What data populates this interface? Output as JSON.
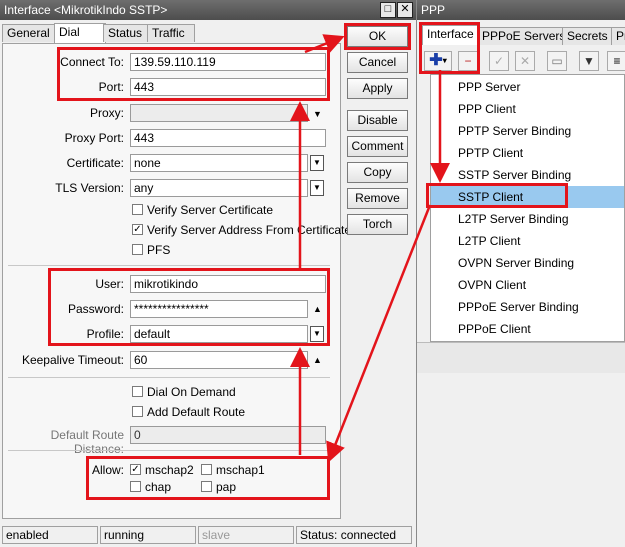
{
  "left_window": {
    "title": "Interface <MikrotikIndo SSTP>",
    "tabs": [
      "General",
      "Dial Out",
      "Status",
      "Traffic"
    ],
    "fields": {
      "connect_to": {
        "label": "Connect To:",
        "value": "139.59.110.119"
      },
      "port": {
        "label": "Port:",
        "value": "443"
      },
      "proxy": {
        "label": "Proxy:",
        "value": ""
      },
      "proxy_port": {
        "label": "Proxy Port:",
        "value": "443"
      },
      "certificate": {
        "label": "Certificate:",
        "value": "none"
      },
      "tls_version": {
        "label": "TLS Version:",
        "value": "any"
      },
      "user": {
        "label": "User:",
        "value": "mikrotikindo"
      },
      "password": {
        "label": "Password:",
        "value": "****************"
      },
      "profile": {
        "label": "Profile:",
        "value": "default"
      },
      "keepalive": {
        "label": "Keepalive Timeout:",
        "value": "60"
      },
      "route_distance": {
        "label": "Default Route Distance:",
        "value": "0"
      },
      "allow_label": "Allow:"
    },
    "checkboxes": {
      "verify_server_cert": {
        "label": "Verify Server Certificate",
        "checked": false
      },
      "verify_server_addr": {
        "label": "Verify Server Address From Certificate",
        "checked": true
      },
      "pfs": {
        "label": "PFS",
        "checked": false
      },
      "dial_on_demand": {
        "label": "Dial On Demand",
        "checked": false
      },
      "add_default_route": {
        "label": "Add Default Route",
        "checked": false
      },
      "mschap2": {
        "label": "mschap2",
        "checked": true
      },
      "mschap1": {
        "label": "mschap1",
        "checked": false
      },
      "chap": {
        "label": "chap",
        "checked": false
      },
      "pap": {
        "label": "pap",
        "checked": false
      }
    },
    "buttons": [
      "OK",
      "Cancel",
      "Apply",
      "Disable",
      "Comment",
      "Copy",
      "Remove",
      "Torch"
    ],
    "status": [
      "enabled",
      "running",
      "slave",
      "Status: connected"
    ]
  },
  "right_window": {
    "title": "PPP",
    "tabs": [
      "Interface",
      "PPPoE Servers",
      "Secrets",
      "Pr"
    ],
    "menu_items": [
      "PPP Server",
      "PPP Client",
      "PPTP Server Binding",
      "PPTP Client",
      "SSTP Server Binding",
      "SSTP Client",
      "L2TP Server Binding",
      "L2TP Client",
      "OVPN Server Binding",
      "OVPN Client",
      "PPPoE Server Binding",
      "PPPoE Client"
    ],
    "selected_item": "SSTP Client"
  },
  "colors": {
    "highlight": "#e3141b",
    "selection": "#99c9ef",
    "titlebar": "#5a5a5a",
    "add_icon": "#1a3fa8"
  }
}
